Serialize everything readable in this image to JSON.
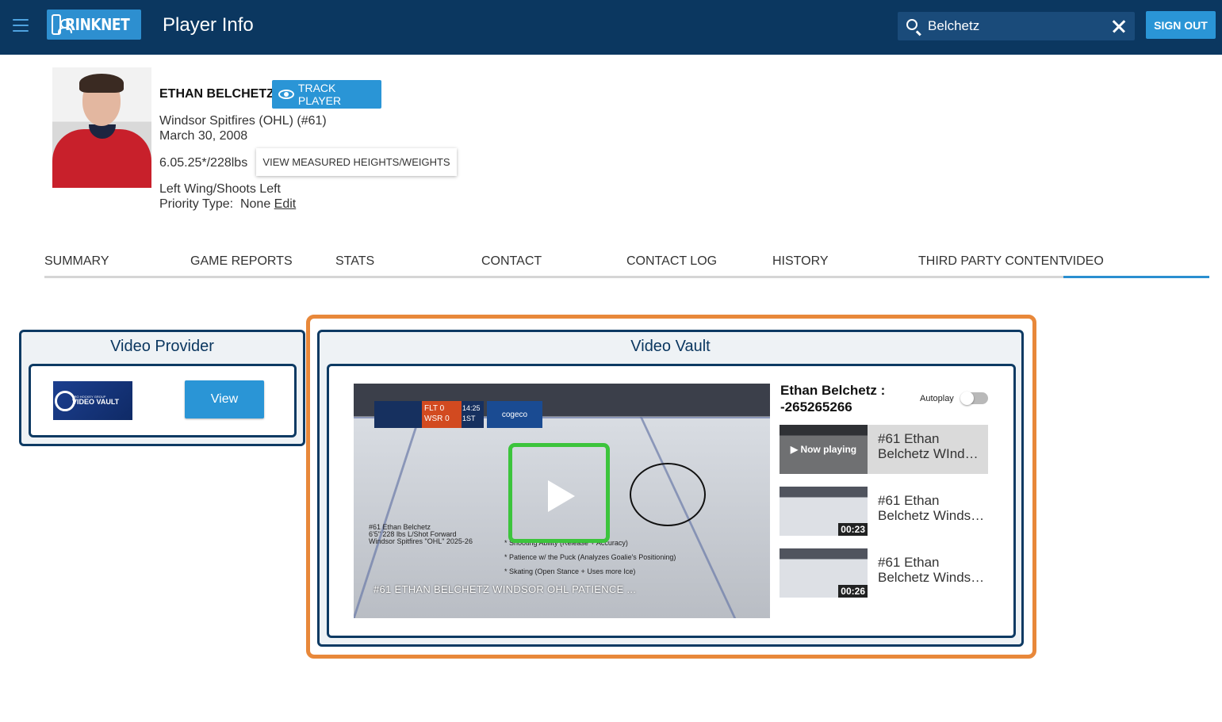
{
  "header": {
    "logo_text": "RINKNET",
    "title": "Player Info",
    "search_value": "Belchetz",
    "signout_label": "SIGN OUT"
  },
  "player": {
    "name": "ETHAN BELCHETZ",
    "track_label": "TRACK PLAYER",
    "team": "Windsor Spitfires (OHL) (#61)",
    "dob": "March 30, 2008",
    "height_weight": "6.05.25*/228lbs",
    "measure_label": "VIEW MEASURED HEIGHTS/WEIGHTS",
    "position": "Left Wing/Shoots Left",
    "priority_label": "Priority Type:",
    "priority_value": "None",
    "edit_label": "Edit"
  },
  "tabs": [
    {
      "label": "SUMMARY"
    },
    {
      "label": "GAME REPORTS"
    },
    {
      "label": "STATS"
    },
    {
      "label": "CONTACT"
    },
    {
      "label": "CONTACT LOG"
    },
    {
      "label": "HISTORY"
    },
    {
      "label": "THIRD PARTY CONTENT"
    },
    {
      "label": "VIDEO",
      "active": true
    }
  ],
  "video_provider": {
    "title": "Video Provider",
    "logo_small": "PRO HOCKEY GROUP",
    "logo_text": "VIDEO VAULT",
    "view_label": "View"
  },
  "video_vault": {
    "title": "Video Vault",
    "player": {
      "video_title": "#61 ETHAN BELCHETZ WINDSOR OHL PATIENCE ...",
      "caption_line1": "#61 Ethan Belchetz",
      "caption_line2": "6'5\" 228 lbs L/Shot Forward",
      "caption_line3": "Windsor Spitfires \"OHL\" 2025-26",
      "bullet1": "* Shooting Ability (Release + Accuracy)",
      "bullet2": "* Patience w/ the Puck (Analyzes Goalie's Positioning)",
      "bullet3": "* Skating (Open Stance + Uses more Ice)",
      "scoreboard_team1": "FLT",
      "scoreboard_score1": "0",
      "scoreboard_team2": "WSR",
      "scoreboard_score2": "0",
      "scoreboard_time": "14:25",
      "scoreboard_period": "1ST",
      "sponsor": "cogeco"
    },
    "playlist_title": "Ethan Belchetz : -265265266",
    "autoplay_label": "Autoplay",
    "autoplay_on": false,
    "items": [
      {
        "title": "#61 Ethan Belchetz WInd…",
        "overlay": "▶ Now playing",
        "duration": ""
      },
      {
        "title": "#61 Ethan Belchetz Winds…",
        "overlay": "",
        "duration": "00:23"
      },
      {
        "title": "#61 Ethan Belchetz Winds…",
        "overlay": "",
        "duration": "00:26"
      }
    ]
  },
  "colors": {
    "topbar": "#0b3760",
    "accent": "#2a95d6",
    "panel_border": "#0d3a63",
    "highlight": "#e8883a",
    "focus_box": "#3cc43c"
  }
}
